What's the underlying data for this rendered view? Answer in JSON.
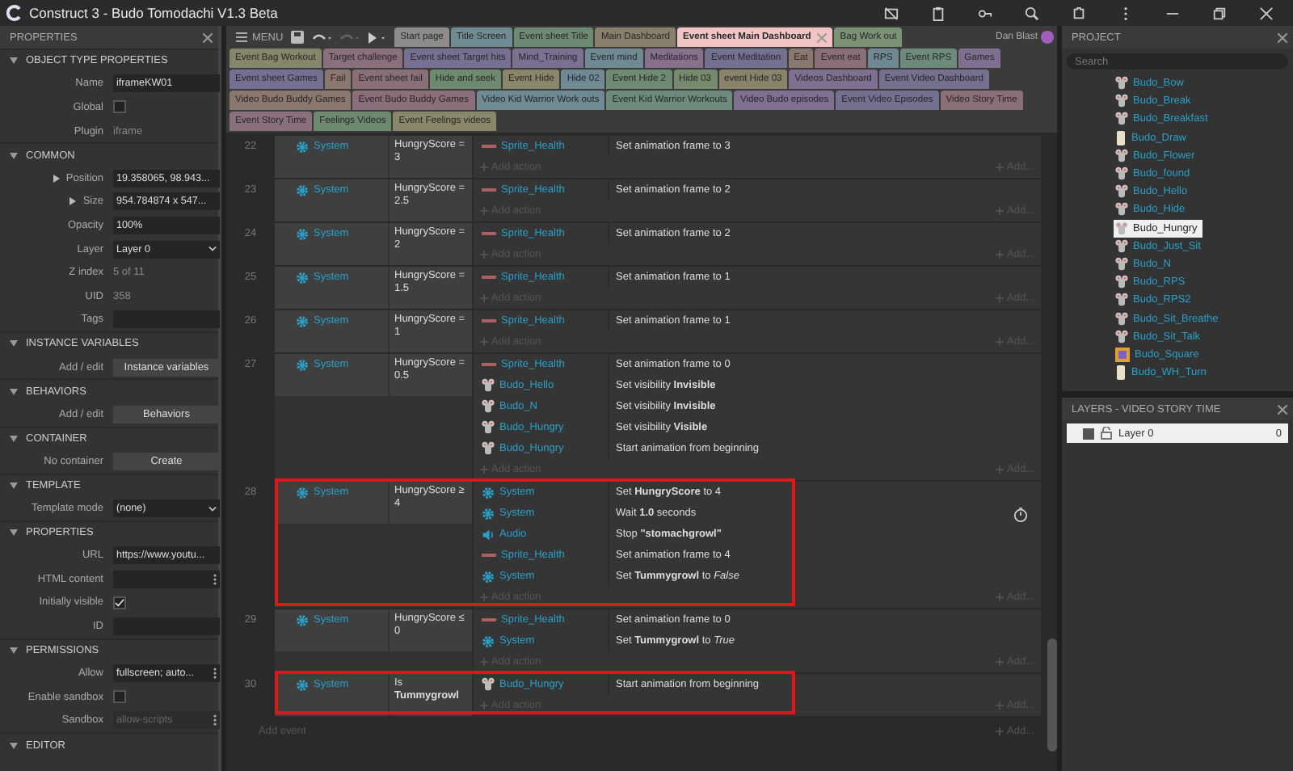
{
  "window": {
    "title": "Construct 3 - Budo Tomodachi V1.3 Beta"
  },
  "properties_panel": {
    "title": "PROPERTIES",
    "sections": [
      {
        "title": "OBJECT TYPE PROPERTIES",
        "rows": [
          {
            "label": "Name",
            "kind": "input",
            "value": "iframeKW01"
          },
          {
            "label": "Global",
            "kind": "checkbox",
            "checked": false
          },
          {
            "label": "Plugin",
            "kind": "text",
            "value": "iframe"
          }
        ]
      },
      {
        "title": "COMMON",
        "rows": [
          {
            "label": "Position",
            "kind": "input",
            "value": "19.358065, 98.943...",
            "expandable": true
          },
          {
            "label": "Size",
            "kind": "input",
            "value": "954.784874 x 547...",
            "expandable": true
          },
          {
            "label": "Opacity",
            "kind": "input",
            "value": "100%"
          },
          {
            "label": "Layer",
            "kind": "select",
            "value": "Layer 0"
          },
          {
            "label": "Z index",
            "kind": "text",
            "value": "5 of 11"
          },
          {
            "label": "UID",
            "kind": "text",
            "value": "358"
          },
          {
            "label": "Tags",
            "kind": "input",
            "value": ""
          }
        ]
      },
      {
        "title": "INSTANCE VARIABLES",
        "rows": [
          {
            "label": "Add / edit",
            "kind": "button",
            "value": "Instance variables"
          }
        ]
      },
      {
        "title": "BEHAVIORS",
        "rows": [
          {
            "label": "Add / edit",
            "kind": "button",
            "value": "Behaviors"
          }
        ]
      },
      {
        "title": "CONTAINER",
        "rows": [
          {
            "label": "No container",
            "kind": "button",
            "value": "Create"
          }
        ]
      },
      {
        "title": "TEMPLATE",
        "rows": [
          {
            "label": "Template mode",
            "kind": "select",
            "value": "(none)"
          }
        ]
      },
      {
        "title": "PROPERTIES",
        "rows": [
          {
            "label": "URL",
            "kind": "input",
            "value": "https://www.youtu..."
          },
          {
            "label": "HTML content",
            "kind": "menu",
            "value": ""
          },
          {
            "label": "Initially visible",
            "kind": "checkbox",
            "checked": true
          },
          {
            "label": "ID",
            "kind": "input",
            "value": ""
          }
        ]
      },
      {
        "title": "PERMISSIONS",
        "rows": [
          {
            "label": "Allow",
            "kind": "menu",
            "value": "fullscreen; auto..."
          },
          {
            "label": "Enable sandbox",
            "kind": "checkbox",
            "checked": false
          },
          {
            "label": "Sandbox",
            "kind": "menu",
            "placeholder": "allow-scripts",
            "disabled": true
          }
        ]
      },
      {
        "title": "EDITOR"
      }
    ]
  },
  "toolbar": {
    "menu_label": "MENU",
    "user": "Dan Blast"
  },
  "tab_rows": [
    [
      {
        "label": "Start page",
        "color": "#8c8c8c",
        "selected": false
      },
      {
        "label": "Title Screen",
        "color": "#6f8c92",
        "selected": false
      },
      {
        "label": "Event sheet Title",
        "color": "#6e8a72",
        "selected": false
      },
      {
        "label": "Main Dashboard",
        "color": "#8a7f6c",
        "selected": false
      },
      {
        "label": "Event sheet Main Dashboard",
        "color": "#f3c4c4",
        "selected": true
      },
      {
        "label": "Bag Work out",
        "color": "#7b9276",
        "selected": false
      }
    ],
    [
      {
        "label": "Event Bag Workout",
        "color": "#86866a",
        "selected": false
      },
      {
        "label": "Target challenge",
        "color": "#8a6f7c",
        "selected": false
      },
      {
        "label": "Event sheet Target hits",
        "color": "#787092",
        "selected": false
      },
      {
        "label": "Mind_Training",
        "color": "#7c7092",
        "selected": false
      },
      {
        "label": "Event mind",
        "color": "#6f8a92",
        "selected": false
      },
      {
        "label": "Meditations",
        "color": "#86708c",
        "selected": false
      },
      {
        "label": "Event Meditation",
        "color": "#747092",
        "selected": false
      },
      {
        "label": "Eat",
        "color": "#8a786e",
        "selected": false
      },
      {
        "label": "Event eat",
        "color": "#8a6f76",
        "selected": false
      },
      {
        "label": "RPS",
        "color": "#6f8892",
        "selected": false
      },
      {
        "label": "Event RPS",
        "color": "#6e8a7a",
        "selected": false
      },
      {
        "label": "Games",
        "color": "#806f90",
        "selected": false
      }
    ],
    [
      {
        "label": "Event sheet Games",
        "color": "#766f92",
        "selected": false
      },
      {
        "label": "Fail",
        "color": "#8a786e",
        "selected": false
      },
      {
        "label": "Event sheet fail",
        "color": "#8a6f76",
        "selected": false
      },
      {
        "label": "Hide and seek",
        "color": "#6e8a6e",
        "selected": false
      },
      {
        "label": "Event Hide",
        "color": "#8a866a",
        "selected": false
      },
      {
        "label": "Hide 02",
        "color": "#6f8a92",
        "selected": false
      },
      {
        "label": "Event Hide 2",
        "color": "#6e8a72",
        "selected": false
      },
      {
        "label": "Hide 03",
        "color": "#768a6e",
        "selected": false
      },
      {
        "label": "event Hide 03",
        "color": "#8a826a",
        "selected": false
      },
      {
        "label": "Videos Dashboard",
        "color": "#806f90",
        "selected": false
      },
      {
        "label": "Event Video Dashboard",
        "color": "#74708f",
        "selected": false
      }
    ],
    [
      {
        "label": "Video Budo Buddy Games",
        "color": "#8a786e",
        "selected": false
      },
      {
        "label": "Event Budo Buddy Games",
        "color": "#8a6f7a",
        "selected": false
      },
      {
        "label": "Video Kid Warrior Work outs",
        "color": "#6f8a92",
        "selected": false
      },
      {
        "label": "Event Kid Warrior Workouts",
        "color": "#6e8a7a",
        "selected": false
      },
      {
        "label": "Video Budo episodes",
        "color": "#806f90",
        "selected": false
      },
      {
        "label": "Event Video Episodes",
        "color": "#74708f",
        "selected": false
      },
      {
        "label": "Video Story Time",
        "color": "#8a6f76",
        "selected": false
      }
    ],
    [
      {
        "label": "Event Story Time",
        "color": "#8a6f7c",
        "selected": false
      },
      {
        "label": "Feelings Videos",
        "color": "#6e8a6e",
        "selected": false
      },
      {
        "label": "Event Feelings videos",
        "color": "#8a866a",
        "selected": false
      }
    ]
  ],
  "event_sheet": {
    "add_event": "Add event",
    "add_event_right": "Add...",
    "events": [
      {
        "number": "22",
        "object": "System",
        "condition": "HungryScore = 3",
        "highlighted": false,
        "wait_icon": false,
        "add_action": "Add action",
        "add": "Add...",
        "actions": [
          {
            "kind": "sprite",
            "object": "Sprite_Health",
            "text": "Set animation frame to 3"
          }
        ]
      },
      {
        "number": "23",
        "object": "System",
        "condition": "HungryScore = 2.5",
        "highlighted": false,
        "wait_icon": false,
        "add_action": "Add action",
        "add": "Add...",
        "actions": [
          {
            "kind": "sprite",
            "object": "Sprite_Health",
            "text": "Set animation frame to 2"
          }
        ]
      },
      {
        "number": "24",
        "object": "System",
        "condition": "HungryScore = 2",
        "highlighted": false,
        "wait_icon": false,
        "add_action": "Add action",
        "add": "Add...",
        "actions": [
          {
            "kind": "sprite",
            "object": "Sprite_Health",
            "text": "Set animation frame to 2"
          }
        ]
      },
      {
        "number": "25",
        "object": "System",
        "condition": "HungryScore = 1.5",
        "highlighted": false,
        "wait_icon": false,
        "add_action": "Add action",
        "add": "Add...",
        "actions": [
          {
            "kind": "sprite",
            "object": "Sprite_Health",
            "text": "Set animation frame to 1"
          }
        ]
      },
      {
        "number": "26",
        "object": "System",
        "condition": "HungryScore = 1",
        "highlighted": false,
        "wait_icon": false,
        "add_action": "Add action",
        "add": "Add...",
        "actions": [
          {
            "kind": "sprite",
            "object": "Sprite_Health",
            "text": "Set animation frame to 1"
          }
        ]
      },
      {
        "number": "27",
        "object": "System",
        "condition": "HungryScore = 0.5",
        "highlighted": false,
        "wait_icon": false,
        "add_action": "Add action",
        "add": "Add...",
        "actions": [
          {
            "kind": "sprite",
            "object": "Sprite_Health",
            "text": "Set animation frame to 0"
          },
          {
            "kind": "mouse",
            "object": "Budo_Hello",
            "text": "Set visibility **Invisible**"
          },
          {
            "kind": "mouse",
            "object": "Budo_N",
            "text": "Set visibility **Invisible**"
          },
          {
            "kind": "mouse",
            "object": "Budo_Hungry",
            "text": "Set visibility **Visible**"
          },
          {
            "kind": "mouse",
            "object": "Budo_Hungry",
            "text": "Start animation from beginning"
          }
        ]
      },
      {
        "number": "28",
        "object": "System",
        "condition": "HungryScore ≥ 4",
        "highlighted": true,
        "wait_icon": true,
        "add_action": "Add action",
        "add": "Add...",
        "actions": [
          {
            "kind": "system",
            "object": "System",
            "text": "Set **HungryScore** to 4"
          },
          {
            "kind": "system",
            "object": "System",
            "text": "Wait **1.0** seconds"
          },
          {
            "kind": "audio",
            "object": "Audio",
            "text": "Stop **\"stomachgrowl\"**"
          },
          {
            "kind": "sprite",
            "object": "Sprite_Health",
            "text": "Set animation frame to 4"
          },
          {
            "kind": "system",
            "object": "System",
            "text": "Set **Tummygrowl** to *False*"
          }
        ]
      },
      {
        "number": "29",
        "object": "System",
        "condition": "HungryScore ≤ 0",
        "highlighted": false,
        "wait_icon": false,
        "add_action": "Add action",
        "add": "Add...",
        "actions": [
          {
            "kind": "sprite",
            "object": "Sprite_Health",
            "text": "Set animation frame to 0"
          },
          {
            "kind": "system",
            "object": "System",
            "text": "Set **Tummygrowl** to *True*"
          }
        ]
      },
      {
        "number": "30",
        "object": "System",
        "condition": "Is **Tummygrowl**",
        "highlighted": true,
        "wait_icon": false,
        "add_action": "Add action",
        "add": "Add...",
        "actions": [
          {
            "kind": "mouse",
            "object": "Budo_Hungry",
            "text": "Start animation from beginning"
          }
        ]
      }
    ]
  },
  "project_panel": {
    "title": "PROJECT",
    "search_placeholder": "Search",
    "items": [
      {
        "label": "Budo_Bow",
        "kind": "mouse",
        "selected": false
      },
      {
        "label": "Budo_Break",
        "kind": "mouse",
        "selected": false
      },
      {
        "label": "Budo_Breakfast",
        "kind": "mouse",
        "selected": false
      },
      {
        "label": "Budo_Draw",
        "kind": "figure",
        "selected": false
      },
      {
        "label": "Budo_Flower",
        "kind": "mouse",
        "selected": false
      },
      {
        "label": "Budo_found",
        "kind": "mouse",
        "selected": false
      },
      {
        "label": "Budo_Hello",
        "kind": "mouse",
        "selected": false
      },
      {
        "label": "Budo_Hide",
        "kind": "mouse",
        "selected": false
      },
      {
        "label": "Budo_Hungry",
        "kind": "mouse",
        "selected": true
      },
      {
        "label": "Budo_Just_Sit",
        "kind": "mouse",
        "selected": false
      },
      {
        "label": "Budo_N",
        "kind": "mouse",
        "selected": false
      },
      {
        "label": "Budo_RPS",
        "kind": "mouse",
        "selected": false
      },
      {
        "label": "Budo_RPS2",
        "kind": "mouse",
        "selected": false
      },
      {
        "label": "Budo_Sit_Breathe",
        "kind": "mouse",
        "selected": false
      },
      {
        "label": "Budo_Sit_Talk",
        "kind": "mouse",
        "selected": false
      },
      {
        "label": "Budo_Square",
        "kind": "square",
        "selected": false
      },
      {
        "label": "Budo_WH_Turn",
        "kind": "figure",
        "selected": false
      }
    ]
  },
  "layers_panel": {
    "title": "LAYERS - VIDEO STORY TIME",
    "layers": [
      {
        "name": "Layer 0",
        "visible": true,
        "locked": false,
        "count": "0"
      }
    ]
  }
}
